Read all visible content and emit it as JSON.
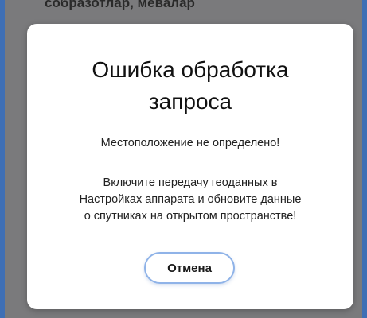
{
  "background": {
    "partial_text": "собразотлар, мевалар"
  },
  "dialog": {
    "title_line1": "Ошибка обработка",
    "title_line2": "запроса",
    "message": "Местоположение не определено!",
    "instructions_line1": "Включите передачу геоданных в",
    "instructions_line2": "Настройках аппарата и обновите данные",
    "instructions_line3": "о спутниках на открытом пространстве!",
    "cancel_label": "Отмена"
  },
  "colors": {
    "frame_border": "#3f6fb5",
    "overlay": "#7a7a7c",
    "dialog_bg": "#ffffff",
    "button_border": "#8fb3e8"
  }
}
